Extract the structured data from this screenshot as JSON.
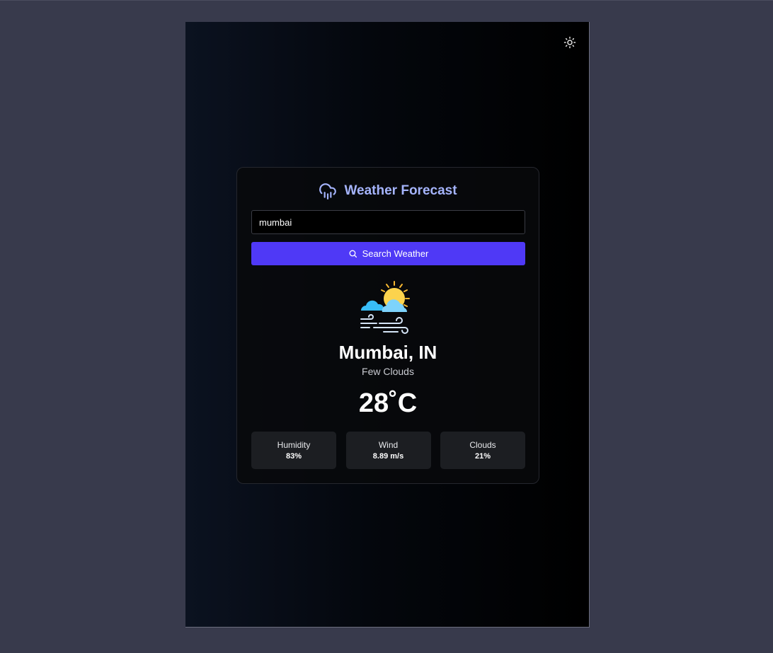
{
  "app": {
    "title": "Weather Forecast",
    "accent_color": "#4f39f6",
    "title_color": "#a5b4fc"
  },
  "header": {
    "theme_toggle_icon": "sun-icon"
  },
  "search": {
    "value": "mumbai",
    "button_label": "Search Weather",
    "button_icon": "search-icon"
  },
  "weather": {
    "icon": "partly-cloudy-windy-icon",
    "city": "Mumbai, IN",
    "description": "Few Clouds",
    "temperature": "28˚C"
  },
  "stats": [
    {
      "label": "Humidity",
      "value": "83%"
    },
    {
      "label": "Wind",
      "value": "8.89 m/s"
    },
    {
      "label": "Clouds",
      "value": "21%"
    }
  ]
}
